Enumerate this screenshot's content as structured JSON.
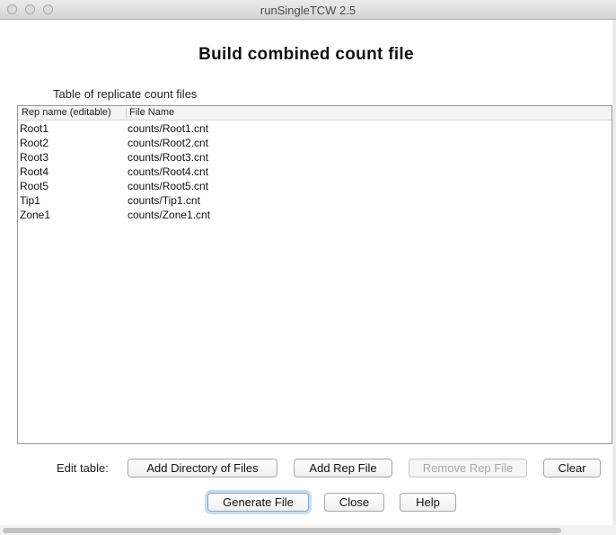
{
  "window": {
    "title": "runSingleTCW 2.5"
  },
  "page": {
    "heading": "Build combined count file",
    "table_caption": "Table of replicate count files"
  },
  "table": {
    "columns": [
      "Rep name (editable)",
      "File Name"
    ],
    "rows": [
      [
        "Root1",
        "counts/Root1.cnt"
      ],
      [
        "Root2",
        "counts/Root2.cnt"
      ],
      [
        "Root3",
        "counts/Root3.cnt"
      ],
      [
        "Root4",
        "counts/Root4.cnt"
      ],
      [
        "Root5",
        "counts/Root5.cnt"
      ],
      [
        "Tip1",
        "counts/Tip1.cnt"
      ],
      [
        "Zone1",
        "counts/Zone1.cnt"
      ]
    ]
  },
  "edit": {
    "label": "Edit table:",
    "add_directory": "Add Directory of Files",
    "add_rep": "Add Rep File",
    "remove_rep": "Remove Rep File",
    "clear": "Clear"
  },
  "actions": {
    "generate": "Generate File",
    "close": "Close",
    "help": "Help"
  }
}
